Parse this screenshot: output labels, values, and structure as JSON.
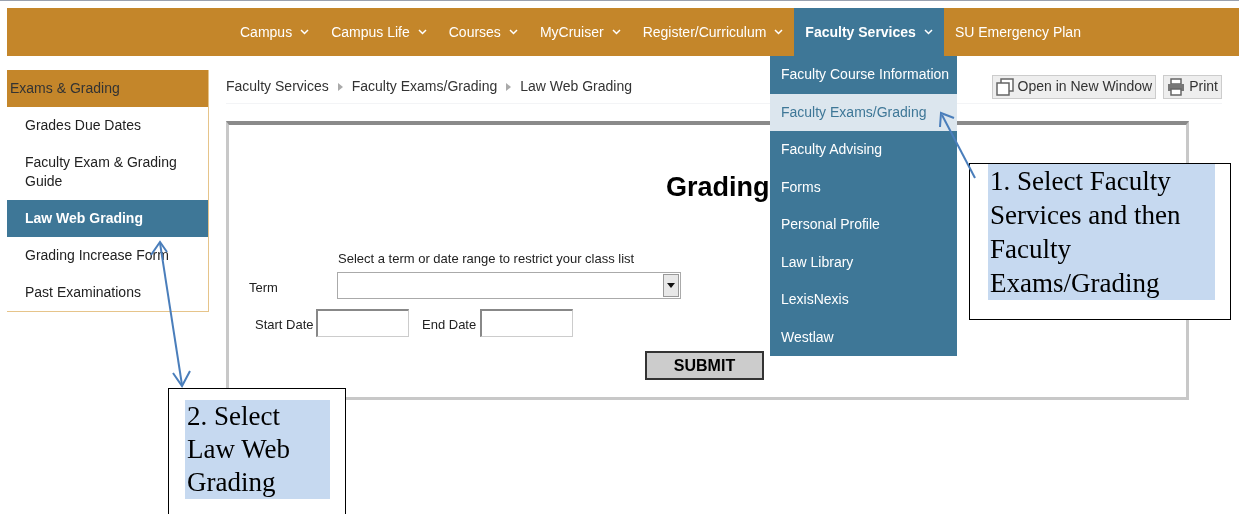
{
  "nav": {
    "items": [
      {
        "label": "Campus",
        "caret": true,
        "selected": false
      },
      {
        "label": "Campus Life",
        "caret": true,
        "selected": false
      },
      {
        "label": "Courses",
        "caret": true,
        "selected": false
      },
      {
        "label": "MyCruiser",
        "caret": true,
        "selected": false
      },
      {
        "label": "Register/Curriculum",
        "caret": true,
        "selected": false
      },
      {
        "label": "Faculty Services",
        "caret": true,
        "selected": true
      },
      {
        "label": "SU Emergency Plan",
        "caret": false,
        "selected": false
      }
    ]
  },
  "dropdown": {
    "items": [
      {
        "label": "Faculty Course Information",
        "selected": false
      },
      {
        "label": "Faculty Exams/Grading",
        "selected": true
      },
      {
        "label": "Faculty Advising",
        "selected": false
      },
      {
        "label": "Forms",
        "selected": false
      },
      {
        "label": "Personal Profile",
        "selected": false
      },
      {
        "label": "Law Library",
        "selected": false
      },
      {
        "label": "LexisNexis",
        "selected": false
      },
      {
        "label": "Westlaw",
        "selected": false
      }
    ]
  },
  "sidebar": {
    "title": "Exams & Grading",
    "items": [
      {
        "label": "Grades Due Dates",
        "selected": false
      },
      {
        "label": "Faculty Exam & Grading Guide",
        "selected": false
      },
      {
        "label": "Law Web Grading",
        "selected": true
      },
      {
        "label": "Grading Increase Form",
        "selected": false
      },
      {
        "label": "Past Examinations",
        "selected": false
      }
    ]
  },
  "breadcrumb": [
    "Faculty Services",
    "Faculty Exams/Grading",
    "Law Web Grading"
  ],
  "actions": [
    {
      "label": "Open in New Window",
      "kind": "new-window"
    },
    {
      "label": "Print",
      "kind": "print"
    }
  ],
  "form": {
    "title": "Grading",
    "instruction": "Select a term or date range to restrict your class list",
    "term_label": "Term",
    "start_label": "Start Date",
    "end_label": "End Date",
    "submit": "SUBMIT"
  },
  "callouts": [
    "1. Select Faculty Services and then Faculty Exams/Grading",
    "2. Select Law Web Grading"
  ]
}
